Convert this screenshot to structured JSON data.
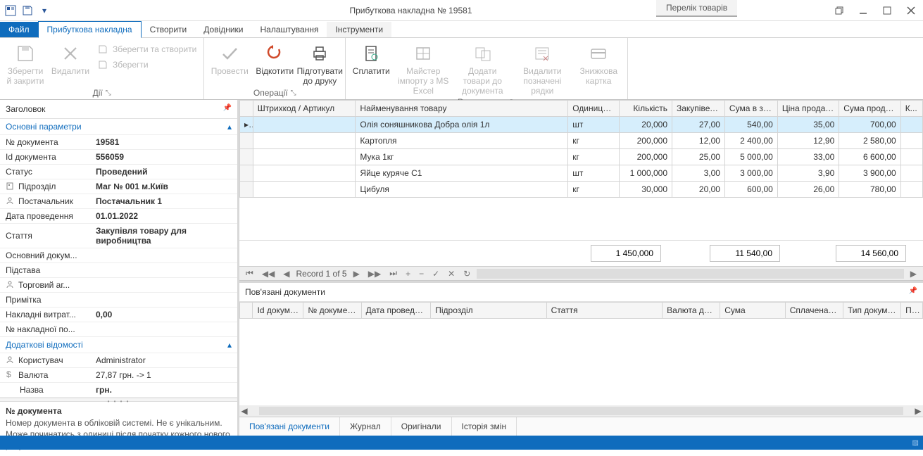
{
  "window": {
    "qat_dropdown": "▾",
    "tab_title": "Перелік товарів",
    "title": "Прибуткова накладна № 19581"
  },
  "menu": {
    "file": "Файл",
    "items": [
      "Прибуткова накладна",
      "Створити",
      "Довідники",
      "Налаштування",
      "Інструменти"
    ]
  },
  "ribbon": {
    "groups": [
      "Дії",
      "Операції",
      "Редагування"
    ],
    "save_close": "Зберегти й закрити",
    "delete": "Видалити",
    "save_create": "Зберегти та створити",
    "save": "Зберегти",
    "post": "Провести",
    "rollback": "Відкотити",
    "prepare_print": "Підготувати до друку",
    "pay": "Сплатити",
    "import_excel": "Майстер імпорту з MS Excel",
    "add_goods": "Додати товари до документа",
    "delete_rows": "Видалити позначені рядки",
    "discount_card": "Знижкова картка"
  },
  "panel": {
    "title": "Заголовок",
    "group_main": "Основні параметри",
    "group_extra": "Додаткові відомості",
    "rows_main": [
      {
        "k": "№ документа",
        "v": "19581",
        "bold": true
      },
      {
        "k": "Id документа",
        "v": "556059",
        "bold": true
      },
      {
        "k": "Статус",
        "v": "Проведений",
        "bold": true
      },
      {
        "k": "Підрозділ",
        "v": "Маг № 001 м.Київ",
        "bold": true,
        "icon": "building"
      },
      {
        "k": "Постачальник",
        "v": "Постачальник 1",
        "bold": true,
        "icon": "person"
      },
      {
        "k": "Дата проведення",
        "v": "01.01.2022",
        "bold": true
      },
      {
        "k": "Стаття",
        "v": "Закупівля товару для виробництва",
        "bold": true
      },
      {
        "k": "Основний докум...",
        "v": ""
      },
      {
        "k": "Підстава",
        "v": ""
      },
      {
        "k": "Торговий аг...",
        "v": "",
        "icon": "person"
      },
      {
        "k": "Примітка",
        "v": ""
      },
      {
        "k": "Накладні витрат...",
        "v": "0,00",
        "bold": true
      },
      {
        "k": "№ накладної по...",
        "v": ""
      }
    ],
    "rows_extra": [
      {
        "k": "Користувач",
        "v": "Administrator",
        "icon": "person"
      },
      {
        "k": "Валюта",
        "v": "27,87 грн. -> 1",
        "icon": "currency"
      },
      {
        "k": "Назва",
        "v": "грн.",
        "bold": true,
        "indent": true
      }
    ],
    "help_title": "№ документа",
    "help_text": "Номер документа в обліковій системі. Не є унікальним. Може починатись з одиниці після початку кожного нового року."
  },
  "grid": {
    "headers": [
      "Штрихкод / Артикул",
      "Найменування товару",
      "Одиниця виміру",
      "Кількість",
      "Закупівельна ціна",
      "Сума в закупівель...",
      "Ціна продажу",
      "Сума продажу",
      "К..."
    ],
    "rows": [
      {
        "name": "Олія соняшникова Добра олія 1л",
        "unit": "шт",
        "qty": "20,000",
        "bprice": "27,00",
        "bsum": "540,00",
        "sprice": "35,00",
        "ssum": "700,00"
      },
      {
        "name": "Картопля",
        "unit": "кг",
        "qty": "200,000",
        "bprice": "12,00",
        "bsum": "2 400,00",
        "sprice": "12,90",
        "ssum": "2 580,00"
      },
      {
        "name": "Мука 1кг",
        "unit": "кг",
        "qty": "200,000",
        "bprice": "25,00",
        "bsum": "5 000,00",
        "sprice": "33,00",
        "ssum": "6 600,00"
      },
      {
        "name": "Яйце куряче С1",
        "unit": "шт",
        "qty": "1 000,000",
        "bprice": "3,00",
        "bsum": "3 000,00",
        "sprice": "3,90",
        "ssum": "3 900,00"
      },
      {
        "name": "Цибуля",
        "unit": "кг",
        "qty": "30,000",
        "bprice": "20,00",
        "bsum": "600,00",
        "sprice": "26,00",
        "ssum": "780,00"
      }
    ],
    "totals": {
      "qty": "1 450,000",
      "bsum": "11 540,00",
      "ssum": "14 560,00"
    },
    "nav_record": "Record 1 of 5"
  },
  "linked": {
    "title": "Пов'язані документи",
    "headers": [
      "Id документа",
      "№ документа",
      "Дата проведення",
      "Підрозділ",
      "Стаття",
      "Валюта документа",
      "Сума",
      "Сплачена сума",
      "Тип документа",
      "П..."
    ]
  },
  "bottom_tabs": [
    "Пов'язані документи",
    "Журнал",
    "Оригінали",
    "Історія змін"
  ]
}
